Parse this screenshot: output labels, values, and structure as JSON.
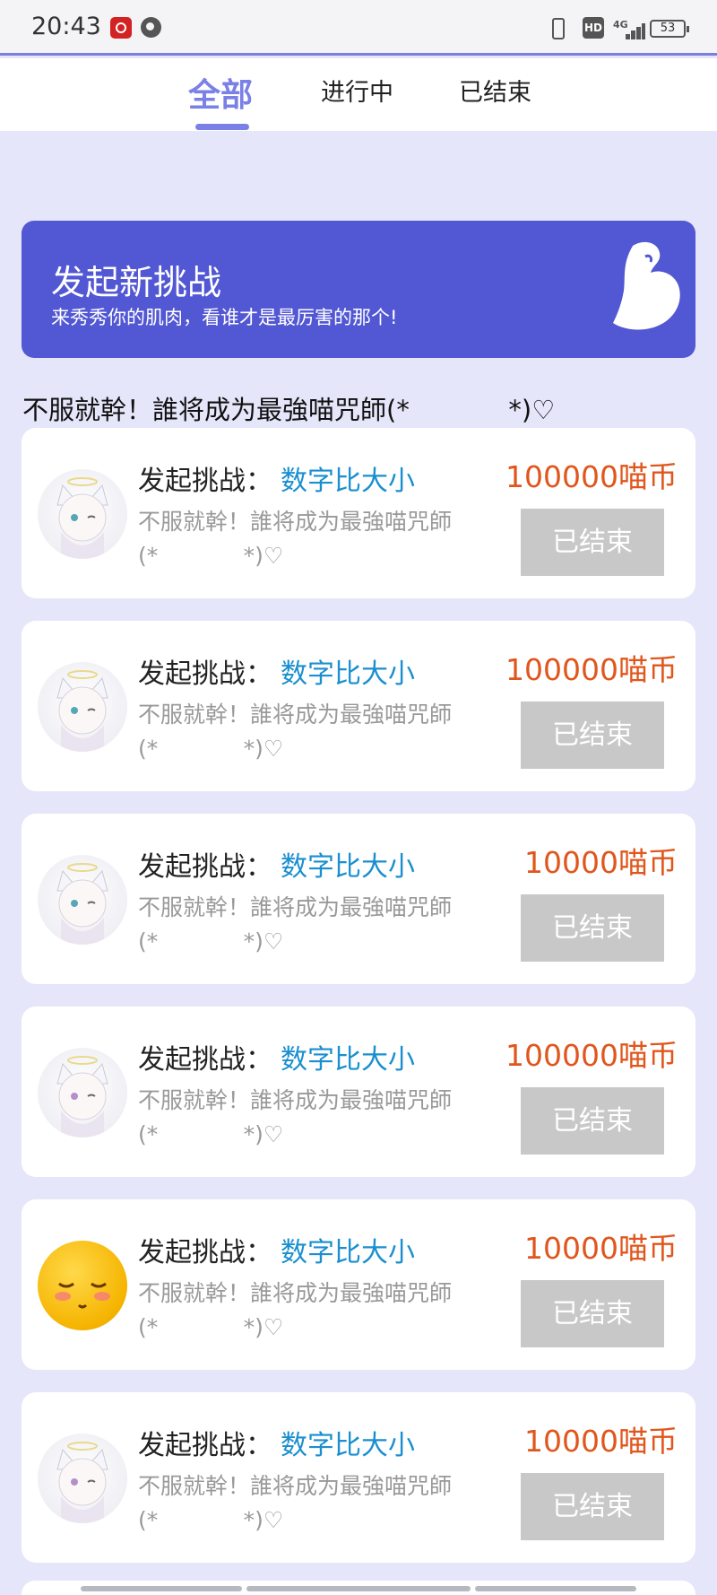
{
  "status_bar": {
    "time": "20:43",
    "hd_label": "HD",
    "network": "4G",
    "battery": "53",
    "icons": [
      "netease-music-icon",
      "browser-icon",
      "vibrate-icon",
      "hd-icon",
      "signal-icon",
      "battery-icon"
    ]
  },
  "tabs": [
    {
      "label": "全部",
      "active": true
    },
    {
      "label": "进行中",
      "active": false
    },
    {
      "label": "已结束",
      "active": false
    }
  ],
  "banner": {
    "title": "发起新挑战",
    "subtitle": "来秀秀你的肌肉，看谁才是最厉害的那个!",
    "icon": "flexed-bicep-icon"
  },
  "section_title": "不服就幹！誰将成为最強喵咒師(*            *)♡",
  "colors": {
    "accent": "#7a80e6",
    "banner": "#5257d3",
    "background": "#e6e6fb",
    "reward": "#e0561c",
    "challenge_type": "#1a8fcf",
    "button_disabled": "#c8c8c8"
  },
  "cards": [
    {
      "label": "发起挑战：",
      "type": "数字比大小",
      "desc": "不服就幹！誰将成为最強喵咒師\n(*            *)♡",
      "reward": "100000喵币",
      "button": "已结束",
      "avatar": "anime-cat-girl-avatar"
    },
    {
      "label": "发起挑战：",
      "type": "数字比大小",
      "desc": "不服就幹！誰将成为最強喵咒師\n(*            *)♡",
      "reward": "100000喵币",
      "button": "已结束",
      "avatar": "anime-cat-girl-avatar"
    },
    {
      "label": "发起挑战：",
      "type": "数字比大小",
      "desc": "不服就幹！誰将成为最強喵咒師\n(*            *)♡",
      "reward": "10000喵币",
      "button": "已结束",
      "avatar": "anime-cat-girl-avatar"
    },
    {
      "label": "发起挑战：",
      "type": "数字比大小",
      "desc": "不服就幹！誰将成为最強喵咒師\n(*            *)♡",
      "reward": "100000喵币",
      "button": "已结束",
      "avatar": "anime-cat-girl-avatar"
    },
    {
      "label": "发起挑战：",
      "type": "数字比大小",
      "desc": "不服就幹！誰将成为最強喵咒師\n(*            *)♡",
      "reward": "10000喵币",
      "button": "已结束",
      "avatar": "blushing-emoji-avatar"
    },
    {
      "label": "发起挑战：",
      "type": "数字比大小",
      "desc": "不服就幹！誰将成为最強喵咒師\n(*            *)♡",
      "reward": "10000喵币",
      "button": "已结束",
      "avatar": "anime-cat-girl-avatar"
    }
  ]
}
